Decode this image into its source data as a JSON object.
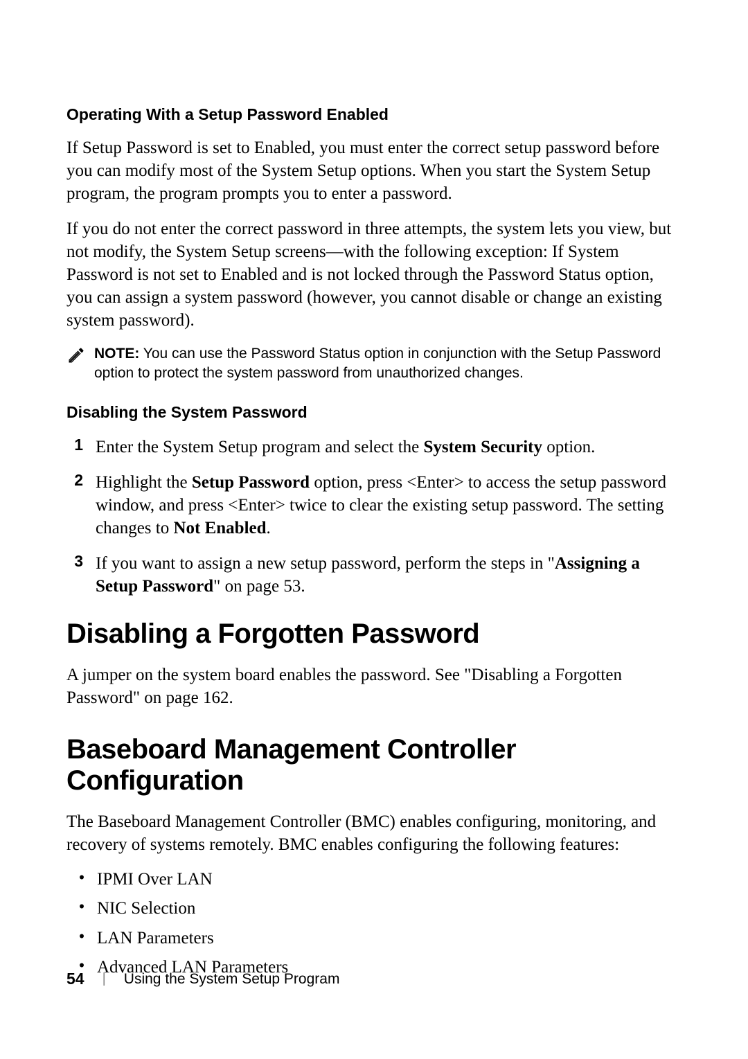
{
  "section1": {
    "heading": "Operating With a Setup Password Enabled",
    "para1": "If Setup Password is set to Enabled, you must enter the correct setup password before you can modify most of the System Setup options. When you start the System Setup program, the program prompts you to enter a password.",
    "para2": "If you do not enter the correct password in three attempts, the system lets you view, but not modify, the System Setup screens—with the following exception: If System Password is not set to Enabled and is not locked through the Password Status option, you can assign a system password (however, you cannot disable or change an existing system password)."
  },
  "note": {
    "label": "NOTE:",
    "text": " You can use the Password Status option in conjunction with the Setup Password option to protect the system password from unauthorized changes."
  },
  "section2": {
    "heading": "Disabling the System Password",
    "steps": [
      {
        "num": "1",
        "pre": "Enter the System Setup program and select the ",
        "bold1": "System Security",
        "post": " option."
      },
      {
        "num": "2",
        "t1": "Highlight the ",
        "b1": "Setup Password",
        "t2": " option, press <Enter> to access the setup password window, and press <Enter> twice to clear the existing setup password. The setting changes to ",
        "b2": "Not Enabled",
        "t3": "."
      },
      {
        "num": "3",
        "t1": "If you want to assign a new setup password, perform the steps in \"",
        "b1": "Assigning a Setup Password",
        "t2": "\" on page 53."
      }
    ]
  },
  "section3": {
    "heading": "Disabling a Forgotten Password",
    "para": "A jumper on the system board enables the password. See \"Disabling a Forgotten Password\" on page 162."
  },
  "section4": {
    "heading": "Baseboard Management Controller Configuration",
    "para": "The Baseboard Management Controller (BMC) enables configuring, monitoring, and recovery of systems remotely. BMC enables configuring the following features:",
    "bullets": [
      "IPMI Over LAN",
      "NIC Selection",
      "LAN Parameters",
      "Advanced LAN Parameters"
    ]
  },
  "footer": {
    "page": "54",
    "divider": "|",
    "text": "Using the System Setup Program"
  }
}
